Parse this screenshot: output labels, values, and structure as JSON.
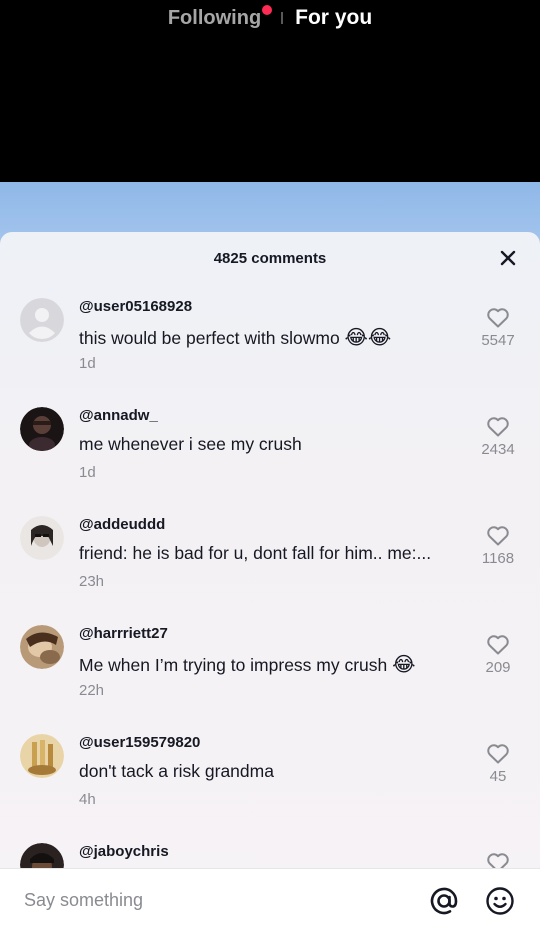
{
  "nav": {
    "following_label": "Following",
    "foryou_label": "For you"
  },
  "sheet": {
    "comment_count_label": "4825 comments"
  },
  "comments": [
    {
      "username": "@user05168928",
      "text": "this would be perfect with slowmo",
      "emoji": "😂😂",
      "time": "1d",
      "likes": "5547",
      "avatar": "default-avatar"
    },
    {
      "username": "@annadw_",
      "text": "me whenever i see my crush",
      "emoji": "",
      "time": "1d",
      "likes": "2434",
      "avatar": "photo-avatar"
    },
    {
      "username": "@addeuddd",
      "text": "friend: he is bad for u, dont fall for him.. me:...",
      "emoji": "",
      "time": "23h",
      "likes": "1168",
      "avatar": "photo-avatar"
    },
    {
      "username": "@harrriett27",
      "text": "Me when I’m trying to impress my crush",
      "emoji": "😂",
      "time": "22h",
      "likes": "209",
      "avatar": "photo-avatar"
    },
    {
      "username": "@user159579820",
      "text": "don't tack a risk grandma",
      "emoji": "",
      "time": "4h",
      "likes": "45",
      "avatar": "photo-avatar"
    },
    {
      "username": "@jaboychris",
      "text": "",
      "emoji": "",
      "time": "",
      "likes": "",
      "avatar": "photo-avatar"
    }
  ],
  "input": {
    "placeholder": "Say something"
  },
  "icons": {
    "close": "close-icon",
    "heart": "heart-icon",
    "mention": "at-sign-icon",
    "emoji": "smiley-icon"
  },
  "colors": {
    "accent_dot": "#fe2c55",
    "text_primary": "#161823",
    "text_secondary": "#8a8b91"
  }
}
